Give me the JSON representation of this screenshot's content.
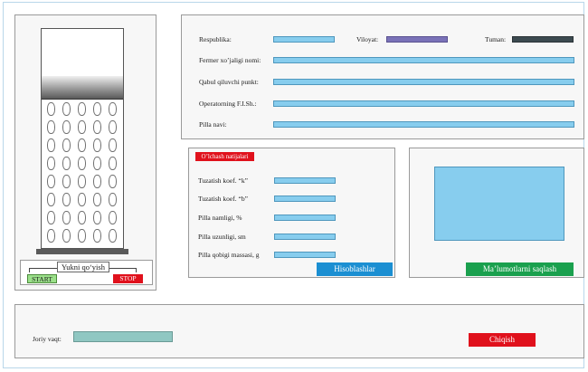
{
  "device": {
    "load_label": "Yukni qo‘yish",
    "start_label": "START",
    "stop_label": "STOP"
  },
  "info": {
    "republic_label": "Respublika:",
    "region_label": "Viloyat:",
    "district_label": "Tuman:",
    "farmer_label": "Fermer xo’jaligi nomi:",
    "reception_label": "Qabul qiluvchi punkt:",
    "operator_label": "Operatorning F.I.Sh.:",
    "cocoon_type_label": "Pilla navi:"
  },
  "results": {
    "header": "O’lchash natijalari",
    "fields": [
      {
        "label": "Tuzatish koef. “k”"
      },
      {
        "label": "Tuzatish koef. “b”"
      },
      {
        "label": "Pilla namligi, %"
      },
      {
        "label": "Pilla uzunligi, sm"
      },
      {
        "label": "Pilla qobigi massasi, g"
      }
    ],
    "calculate_label": "Hisoblashlar"
  },
  "save": {
    "save_label": "Ma’lumotlarni saqlash"
  },
  "footer": {
    "time_label": "Joriy vaqt:",
    "exit_label": "Chiqish"
  },
  "colors": {
    "field_fill": "#87cdee",
    "region_fill": "#7a72b8",
    "district_fill": "#3c4a50",
    "calc_button": "#1b8fd2",
    "save_button": "#1aa04e",
    "exit_button": "#e0111c",
    "start_button": "#9be08a",
    "stop_button": "#e0111c",
    "header_red": "#e0111c"
  }
}
